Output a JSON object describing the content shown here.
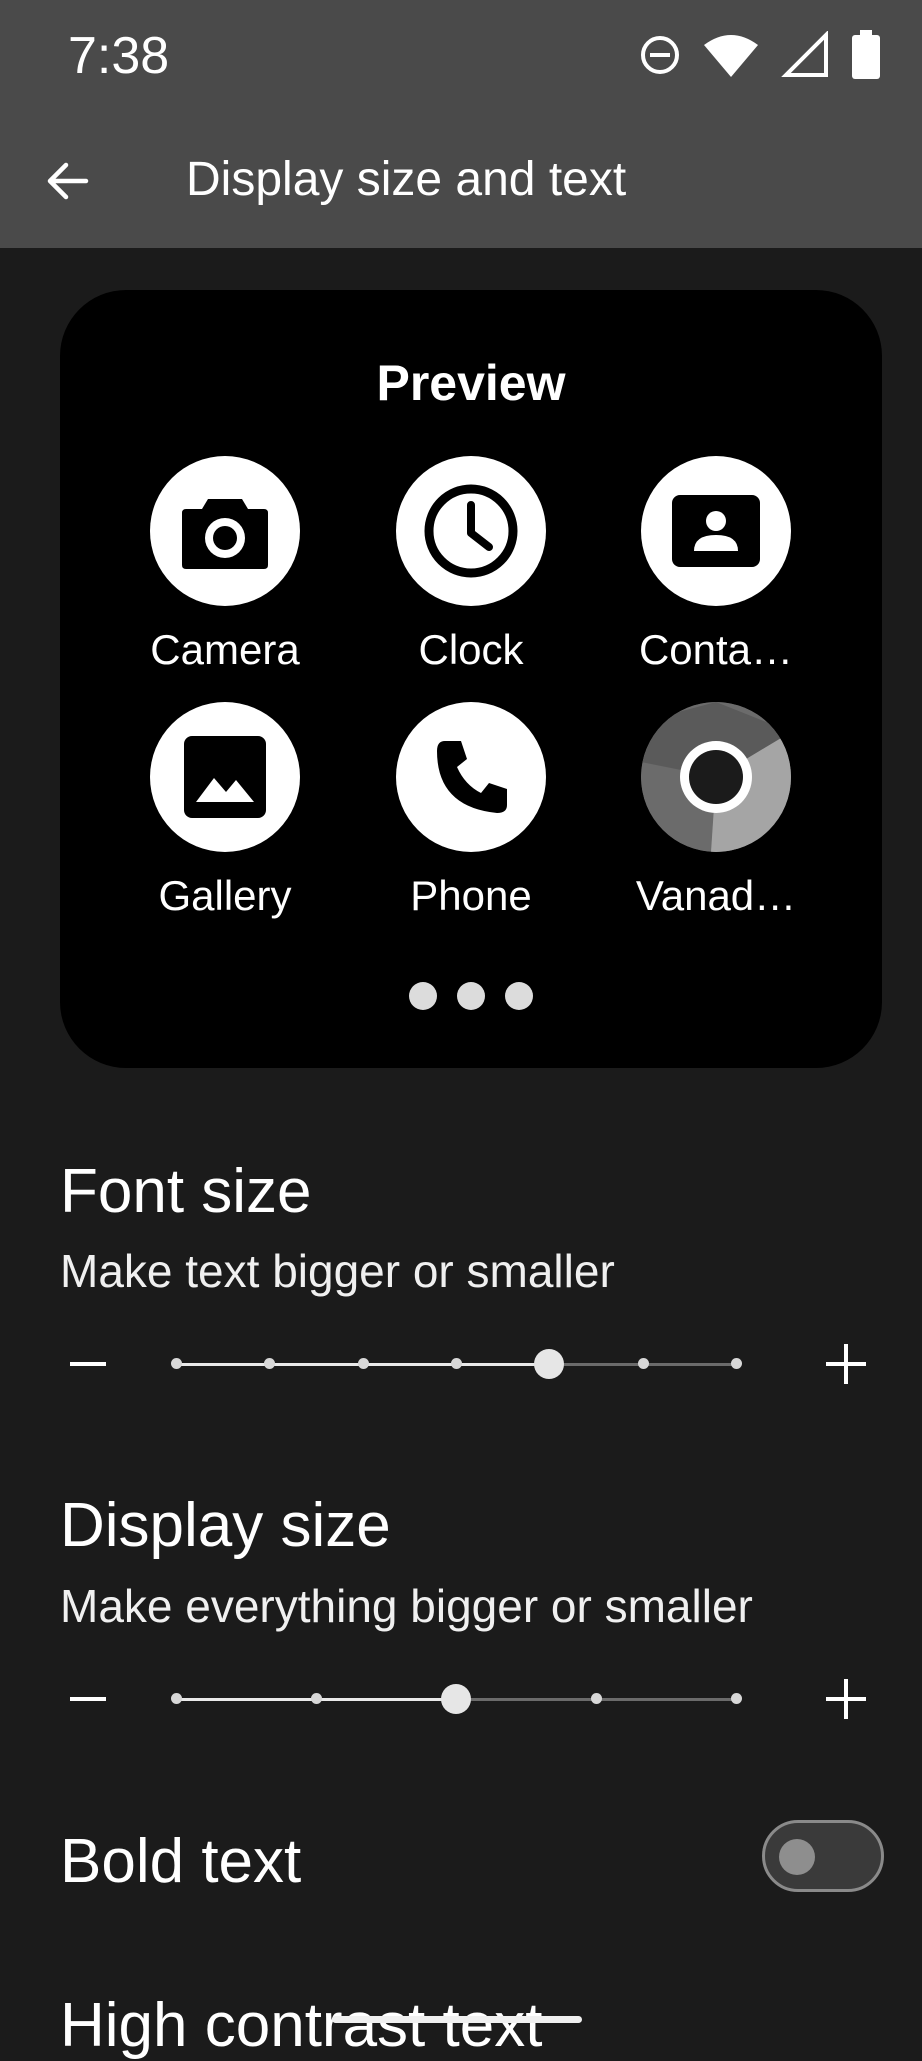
{
  "status_bar": {
    "time": "7:38",
    "icons": [
      "do-not-disturb-icon",
      "wifi-icon",
      "cellular-signal-icon",
      "battery-icon"
    ]
  },
  "app_bar": {
    "title": "Display size and text",
    "back_icon": "arrow-back-icon"
  },
  "preview": {
    "title": "Preview",
    "apps": [
      {
        "label": "Camera",
        "icon": "camera-icon"
      },
      {
        "label": "Clock",
        "icon": "clock-icon"
      },
      {
        "label": "Conta…",
        "icon": "contacts-icon"
      },
      {
        "label": "Gallery",
        "icon": "gallery-icon"
      },
      {
        "label": "Phone",
        "icon": "phone-icon"
      },
      {
        "label": "Vanad…",
        "icon": "vanadium-browser-icon"
      }
    ],
    "page_dots": 3
  },
  "font_size": {
    "title": "Font size",
    "subtitle": "Make text bigger or smaller",
    "steps": 7,
    "selected_index": 4
  },
  "display_size": {
    "title": "Display size",
    "subtitle": "Make everything bigger or smaller",
    "steps": 5,
    "selected_index": 2
  },
  "bold_text": {
    "title": "Bold text",
    "enabled": false
  },
  "high_contrast_text": {
    "title": "High contrast text"
  },
  "colors": {
    "background": "#1b1b1b",
    "bar": "#4a4a4a",
    "card": "#000000"
  }
}
